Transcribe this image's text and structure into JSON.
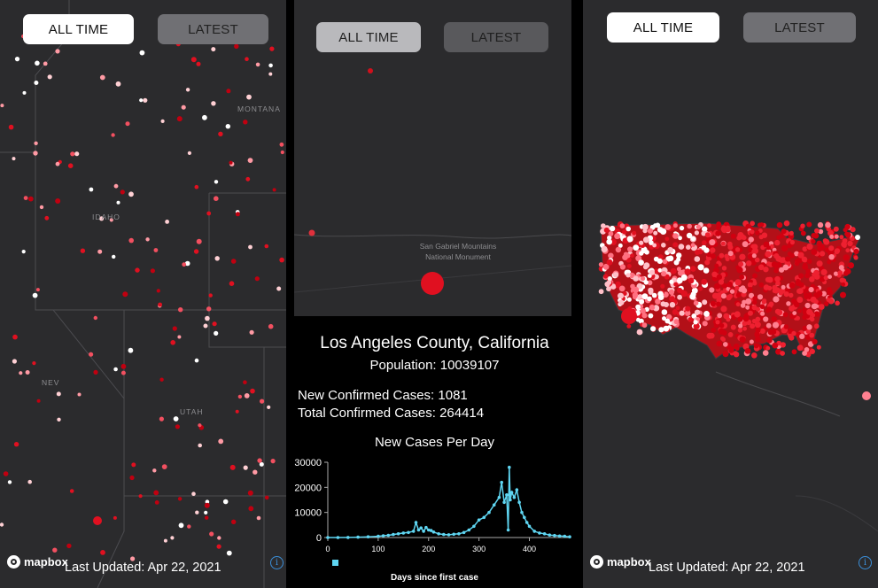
{
  "colors": {
    "map_bg": "#2b2b2d",
    "case_red": "#e01020",
    "chart_line": "#5fd6f2"
  },
  "left_panel": {
    "tab_all_time": "ALL TIME",
    "tab_latest": "LATEST",
    "selected_tab": "ALL TIME",
    "map_labels": {
      "idaho": "IDAHO",
      "montana": "MONTANA",
      "nevada": "NEV",
      "utah": "UTAH"
    },
    "logo_text": "mapbox",
    "last_updated": "Last Updated: Apr 22, 2021",
    "info_icon": "info-icon"
  },
  "middle_panel": {
    "tab_all_time": "ALL TIME",
    "tab_latest": "LATEST",
    "selected_tab": "ALL TIME",
    "map_label_line1": "San Gabriel Mountains",
    "map_label_line2": "National Monument",
    "county_name": "Los Angeles County, California",
    "population": "Population: 10039107",
    "new_confirmed": "New Confirmed Cases: 1081",
    "total_confirmed": "Total Confirmed Cases: 264414"
  },
  "right_panel": {
    "tab_all_time": "ALL TIME",
    "tab_latest": "LATEST",
    "selected_tab": "ALL TIME",
    "logo_text": "mapbox",
    "last_updated": "Last Updated: Apr 22, 2021",
    "info_icon": "info-icon"
  },
  "chart_data": {
    "type": "line",
    "title": "New Cases Per Day",
    "xlabel": "Days since first case",
    "ylabel": "",
    "xlim": [
      0,
      480
    ],
    "ylim": [
      0,
      30000
    ],
    "x_ticks": [
      "0",
      "100",
      "200",
      "300",
      "400"
    ],
    "y_ticks": [
      "0",
      "10000",
      "20000",
      "30000"
    ],
    "grid": false,
    "legend": "bottom-left",
    "series": [
      {
        "name": "",
        "x": [
          0,
          20,
          40,
          60,
          80,
          100,
          110,
          120,
          130,
          140,
          150,
          160,
          170,
          175,
          180,
          185,
          190,
          195,
          200,
          205,
          210,
          220,
          230,
          240,
          250,
          260,
          270,
          280,
          290,
          300,
          310,
          320,
          330,
          340,
          345,
          350,
          355,
          358,
          360,
          362,
          365,
          370,
          375,
          380,
          385,
          390,
          395,
          400,
          410,
          420,
          430,
          440,
          450,
          460,
          470,
          480
        ],
        "y": [
          0,
          0,
          50,
          150,
          300,
          500,
          700,
          900,
          1200,
          1500,
          1800,
          2000,
          2500,
          6000,
          3000,
          3800,
          2500,
          4000,
          3000,
          2800,
          2200,
          1500,
          1200,
          1100,
          1300,
          1500,
          2000,
          3000,
          4500,
          7000,
          8000,
          10000,
          13000,
          16000,
          22000,
          14000,
          17000,
          3000,
          28000,
          15000,
          18000,
          16000,
          19000,
          14000,
          10000,
          8000,
          6000,
          4500,
          2500,
          1800,
          1500,
          1000,
          800,
          600,
          500,
          300
        ]
      }
    ]
  }
}
